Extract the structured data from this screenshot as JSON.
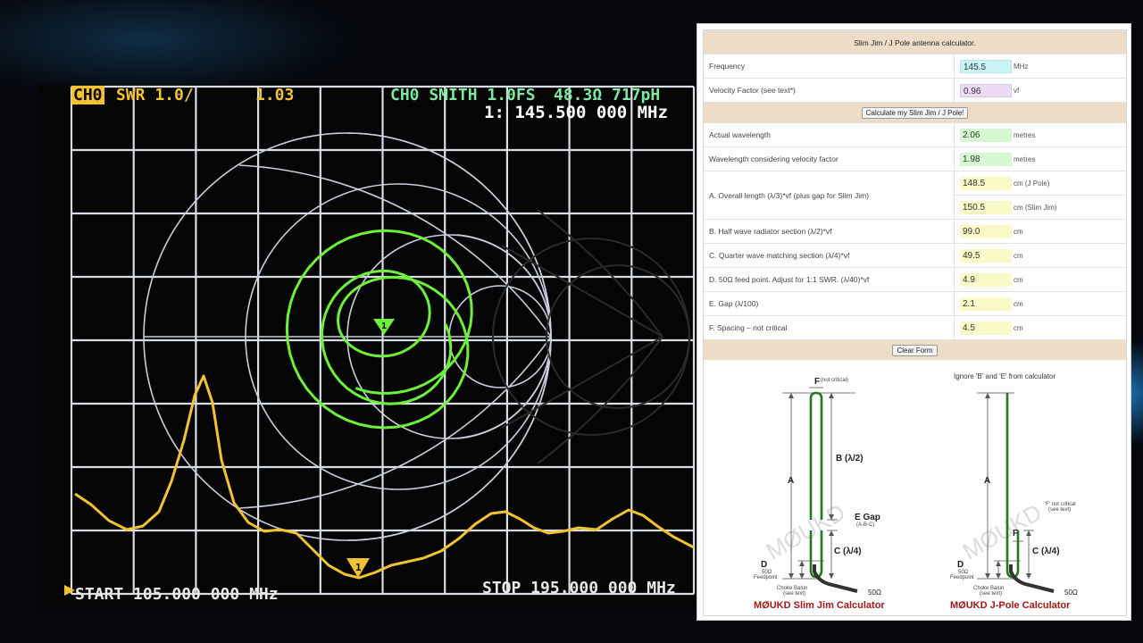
{
  "vna": {
    "ch0_label": "CH0",
    "ch0_swr_label": "SWR 1.0/",
    "ch0_swr_value": "1.03",
    "ch0_smith_label": "CH0 SMITH 1.0FS",
    "ch0_smith_value": "48.3Ω 717pH",
    "marker_readout": "1: 145.500 000 MHz",
    "start_label": "START 105.000 000 MHz",
    "stop_label": "STOP 195.000 000 MHz",
    "marker_number": "1",
    "colors": {
      "smith": "#6cf03a",
      "swr": "#f2c233",
      "grid": "#d9dde6",
      "header_smith": "#7ce8a2"
    }
  },
  "calculator": {
    "title": "Slim Jim / J Pole antenna calculator.",
    "inputs": {
      "frequency": {
        "label": "Frequency",
        "value": "145.5",
        "unit": "MHz",
        "color": "#c8f4f6"
      },
      "velocity_factor": {
        "label": "Velocity Factor (see text*)",
        "value": "0.96",
        "unit": "vf",
        "color": "#ecd9f4"
      }
    },
    "calculate_button": "Calculate my Slim Jim / J Pole!",
    "results": [
      {
        "label": "Actual wavelength",
        "value": "2.06",
        "unit": "metres",
        "color": "#d6f8d0"
      },
      {
        "label": "Wavelength considering velocity factor",
        "value": "1.98",
        "unit": "metres",
        "color": "#d6f8d0"
      }
    ],
    "overall": {
      "label": "A. Overall length (λ/3)*vf (plus gap for Slim Jim)",
      "jpole_value": "148.5",
      "jpole_unit": "cm (J Pole)",
      "slimjim_value": "150.5",
      "slimjim_unit": "cm (Slim Jim)",
      "color": "#fafac8"
    },
    "sections": [
      {
        "label": "B. Half wave radiator section (λ/2)*vf",
        "value": "99.0",
        "unit": "cm"
      },
      {
        "label": "C. Quarter wave matching section (λ/4)*vf",
        "value": "49.5",
        "unit": "cm"
      },
      {
        "label": "D. 50Ω feed point. Adjust for 1:1 SWR. (λ/40)*vf",
        "value": "4.9",
        "unit": "cm"
      },
      {
        "label": "E. Gap (λ/100)",
        "value": "2.1",
        "unit": "cm"
      },
      {
        "label": "F. Spacing – not critical",
        "value": "4.5",
        "unit": "cm"
      }
    ],
    "section_color": "#fafac8",
    "clear_button": "Clear Form",
    "diagram_left": {
      "label_F": "F",
      "label_F_note": "(not critical)",
      "label_A": "A",
      "label_B": "B (λ/2)",
      "label_E": "E Gap",
      "label_E_note": "(A-B-C)",
      "label_C": "C (λ/4)",
      "label_D": "D",
      "label_D_note1": "50Ω",
      "label_D_note2": "Feedpoint",
      "choke1": "Choke Balun",
      "choke2": "(see text)",
      "ohms": "50Ω",
      "watermark": "MØUKD",
      "caption": "MØUKD Slim Jim Calculator"
    },
    "diagram_right": {
      "header": "Ignore 'B' and 'E' from calculator",
      "label_A": "A",
      "label_F": "F",
      "label_F_note1": "'F' not critical",
      "label_F_note2": "(see text)",
      "label_C": "C (λ/4)",
      "label_D": "D",
      "label_D_note1": "50Ω",
      "label_D_note2": "Feedpoint",
      "choke1": "Choke Balun",
      "choke2": "(see text)",
      "ohms": "50Ω",
      "watermark": "MØUKD",
      "caption": "MØUKD J-Pole Calculator"
    }
  }
}
